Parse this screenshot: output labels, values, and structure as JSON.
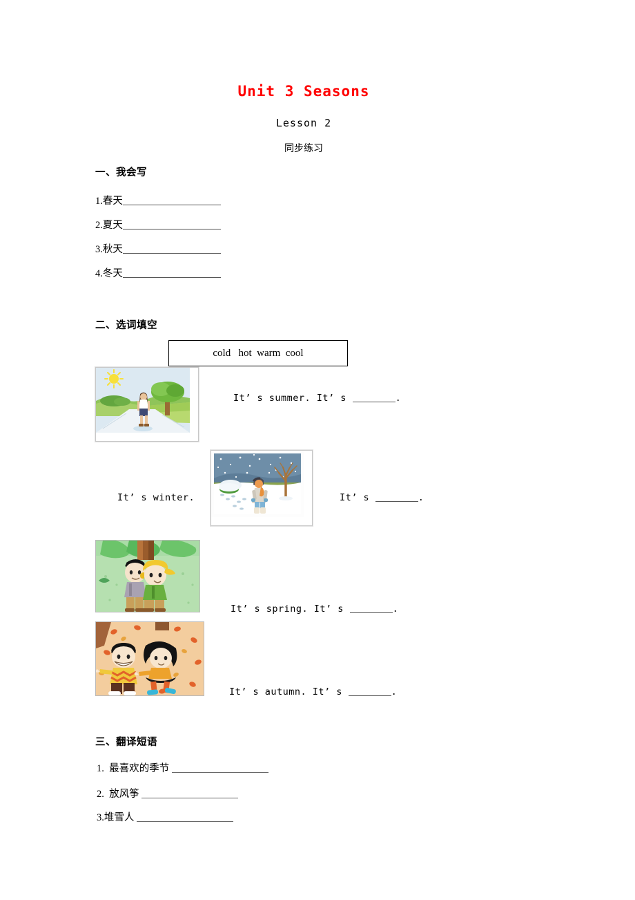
{
  "header": {
    "title": "Unit 3 Seasons",
    "lesson": "Lesson 2",
    "practice": "同步练习"
  },
  "section1": {
    "heading": "一、我会写",
    "items": [
      {
        "num": "1.",
        "word": "春天"
      },
      {
        "num": "2.",
        "word": "夏天"
      },
      {
        "num": "3.",
        "word": "秋天"
      },
      {
        "num": "4.",
        "word": "冬天"
      }
    ]
  },
  "section2": {
    "heading": "二、选词填空",
    "word_bank": "cold   hot  warm  cool",
    "word_bank_options": [
      "cold",
      "hot",
      "warm",
      "cool"
    ],
    "rows": [
      {
        "picture": "summer-scene",
        "picture_alt": "夏天：阳光、绿树、草地上行走的人",
        "prompt_before": "",
        "sentence": "It’ s summer. It’ s ",
        "sentence_end": "."
      },
      {
        "picture": "winter-scene",
        "picture_alt": "冬天：下雪、光秃的树、雪地里行走的人",
        "prompt_before": "It’ s  winter.",
        "sentence": "It’ s ",
        "sentence_end": "."
      },
      {
        "picture": "spring-scene",
        "picture_alt": "春天：绿草地上的两个小朋友",
        "prompt_before": "",
        "sentence": "It’ s spring. It’ s ",
        "sentence_end": "."
      },
      {
        "picture": "autumn-scene",
        "picture_alt": "秋天：落叶中的两个小朋友",
        "prompt_before": "",
        "sentence": "It’ s autumn. It’ s ",
        "sentence_end": "."
      }
    ]
  },
  "section3": {
    "heading": "三、翻译短语",
    "items": [
      {
        "num": "1.",
        "phrase": "最喜欢的季节"
      },
      {
        "num": "2.",
        "phrase": "放风筝"
      },
      {
        "num": "3.",
        "phrase": "堆雪人"
      }
    ]
  },
  "colors": {
    "title": "#ff0000",
    "text": "#000000",
    "rule": "#555555"
  }
}
